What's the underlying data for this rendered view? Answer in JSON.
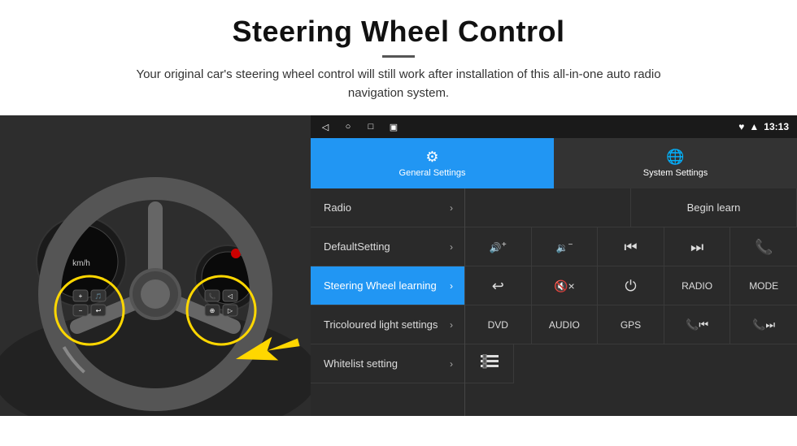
{
  "header": {
    "title": "Steering Wheel Control",
    "subtitle": "Your original car's steering wheel control will still work after installation of this all-in-one auto radio navigation system."
  },
  "status_bar": {
    "time": "13:13",
    "nav_icons": [
      "◁",
      "○",
      "□",
      "▣"
    ]
  },
  "tabs": [
    {
      "id": "general",
      "label": "General Settings",
      "active": true
    },
    {
      "id": "system",
      "label": "System Settings",
      "active": false
    }
  ],
  "menu_items": [
    {
      "id": "radio",
      "label": "Radio",
      "active": false
    },
    {
      "id": "default",
      "label": "DefaultSetting",
      "active": false
    },
    {
      "id": "steering",
      "label": "Steering Wheel learning",
      "active": true
    },
    {
      "id": "tricoloured",
      "label": "Tricoloured light settings",
      "active": false
    },
    {
      "id": "whitelist",
      "label": "Whitelist setting",
      "active": false
    }
  ],
  "controls": {
    "begin_learn_label": "Begin learn",
    "row2_buttons": [
      {
        "id": "vol-up",
        "label": "🔊+",
        "type": "icon"
      },
      {
        "id": "vol-down",
        "label": "🔈−",
        "type": "icon"
      },
      {
        "id": "prev-track",
        "label": "⏮",
        "type": "icon"
      },
      {
        "id": "next-track",
        "label": "⏭",
        "type": "icon"
      },
      {
        "id": "phone",
        "label": "📞",
        "type": "icon"
      }
    ],
    "row3_buttons": [
      {
        "id": "hang-up",
        "label": "↩",
        "type": "icon"
      },
      {
        "id": "mute",
        "label": "🔇×",
        "type": "icon"
      },
      {
        "id": "power",
        "label": "⏻",
        "type": "icon"
      },
      {
        "id": "radio-btn",
        "label": "RADIO",
        "type": "text"
      },
      {
        "id": "mode",
        "label": "MODE",
        "type": "text"
      }
    ],
    "row4_buttons": [
      {
        "id": "dvd",
        "label": "DVD",
        "type": "text"
      },
      {
        "id": "audio",
        "label": "AUDIO",
        "type": "text"
      },
      {
        "id": "gps",
        "label": "GPS",
        "type": "text"
      },
      {
        "id": "tel-prev",
        "label": "📞⏮",
        "type": "icon"
      },
      {
        "id": "tel-next",
        "label": "📞⏭",
        "type": "icon"
      }
    ],
    "row5_button": {
      "id": "list-icon",
      "label": "≡",
      "type": "icon"
    }
  }
}
